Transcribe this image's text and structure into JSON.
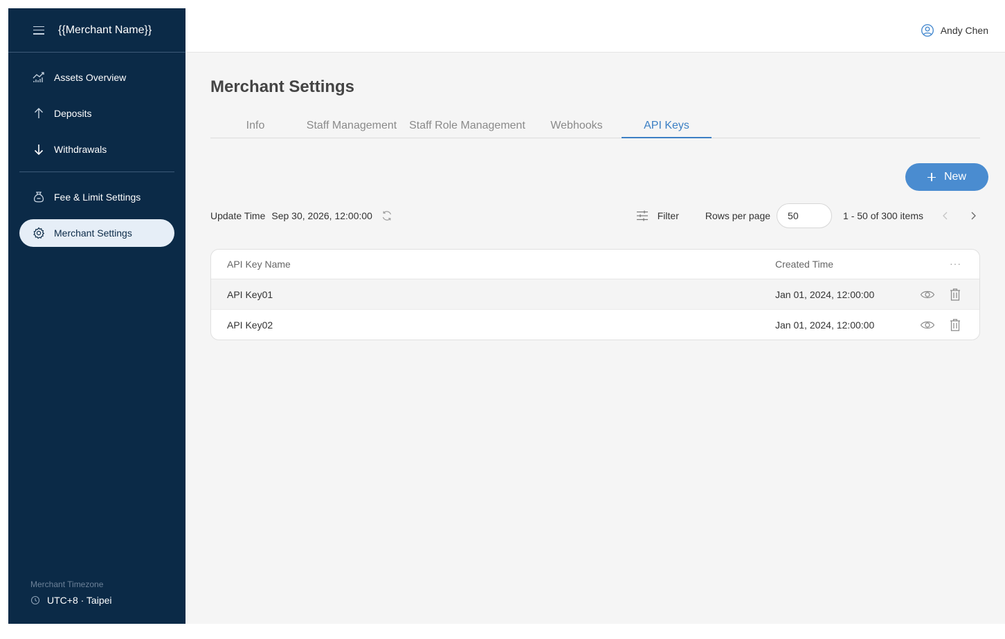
{
  "sidebar": {
    "menu_icon": "hamburger-icon",
    "title": "{{Merchant Name}}",
    "items": [
      {
        "label": "Assets Overview",
        "icon": "chart-icon"
      },
      {
        "label": "Deposits",
        "icon": "arrow-up-icon"
      },
      {
        "label": "Withdrawals",
        "icon": "arrow-down-icon"
      },
      {
        "label": "Fee & Limit Settings",
        "icon": "money-bag-icon"
      },
      {
        "label": "Merchant Settings",
        "icon": "gear-icon",
        "active": true
      }
    ],
    "timezone": {
      "label": "Merchant Timezone",
      "value": "UTC+8 · Taipei",
      "icon": "clock-icon"
    }
  },
  "header": {
    "user_name": "Andy Chen",
    "user_icon": "user-avatar-icon"
  },
  "main": {
    "title": "Merchant Settings",
    "tabs": [
      {
        "label": "Info"
      },
      {
        "label": "Staff Management"
      },
      {
        "label": "Staff Role Management"
      },
      {
        "label": "Webhooks"
      },
      {
        "label": "API Keys",
        "active": true
      }
    ],
    "new_button": "New",
    "toolbar": {
      "update_label": "Update Time",
      "update_time": "Sep 30, 2026, 12:00:00",
      "filter_label": "Filter",
      "rows_per_page_label": "Rows per page",
      "rows_per_page_value": "50",
      "range": "1 - 50 of 300 items"
    },
    "table": {
      "headers": {
        "name": "API Key Name",
        "created": "Created Time",
        "more": "···"
      },
      "rows": [
        {
          "name": "API Key01",
          "created": "Jan 01, 2024, 12:00:00"
        },
        {
          "name": "API Key02",
          "created": "Jan 01, 2024, 12:00:00"
        }
      ]
    }
  },
  "colors": {
    "sidebar_bg": "#0b2a47",
    "accent": "#4a8cd0",
    "active_tab": "#3b7fc4",
    "active_nav_bg": "#e6eef7",
    "main_bg": "#f5f5f5"
  }
}
